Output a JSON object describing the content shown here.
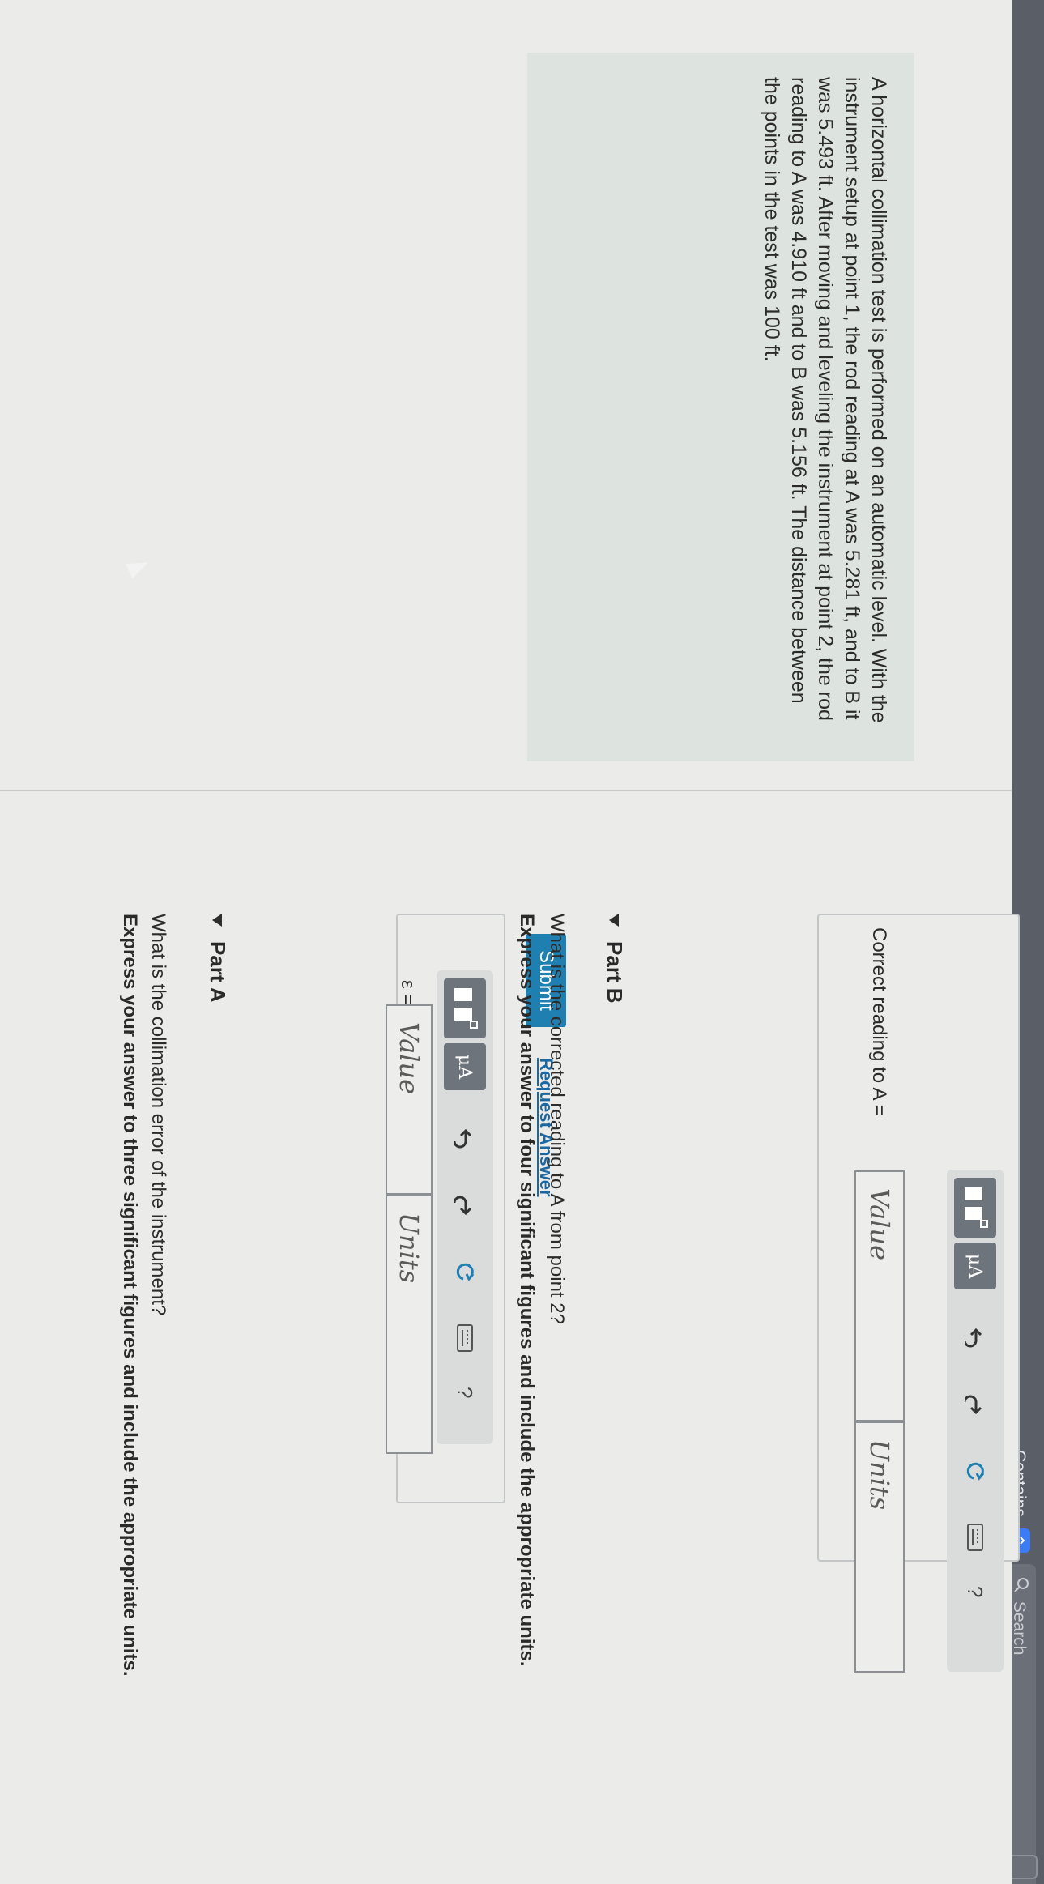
{
  "toolbar": {
    "contains_label": "Contains",
    "search_placeholder": "Search"
  },
  "problem": {
    "text": "A horizontal collimation test is performed on an automatic level. With the instrument setup at point 1, the rod reading at A was 5.281 ft, and to B it was 5.493 ft. After moving and leveling the instrument at point 2, the rod reading to A was 4.910 ft and to B was 5.156 ft. The distance between the points in the test was 100 ft."
  },
  "part_a": {
    "title": "Part A",
    "question": "What is the collimation error of the instrument?",
    "instruction": "Express your answer to three significant figures and include the appropriate units.",
    "equation_label": "ε =",
    "value_placeholder": "Value",
    "units_placeholder": "Units",
    "submit_label": "Submit",
    "request_label": "Request Answer"
  },
  "part_b": {
    "title": "Part B",
    "question": "What is the corrected reading to A from point 2?",
    "instruction": "Express your answer to four significant figures and include the appropriate units.",
    "equation_label": "Correct reading to A =",
    "value_placeholder": "Value",
    "units_placeholder": "Units"
  },
  "tools": {
    "mu_label": "μA",
    "help_label": "?"
  }
}
